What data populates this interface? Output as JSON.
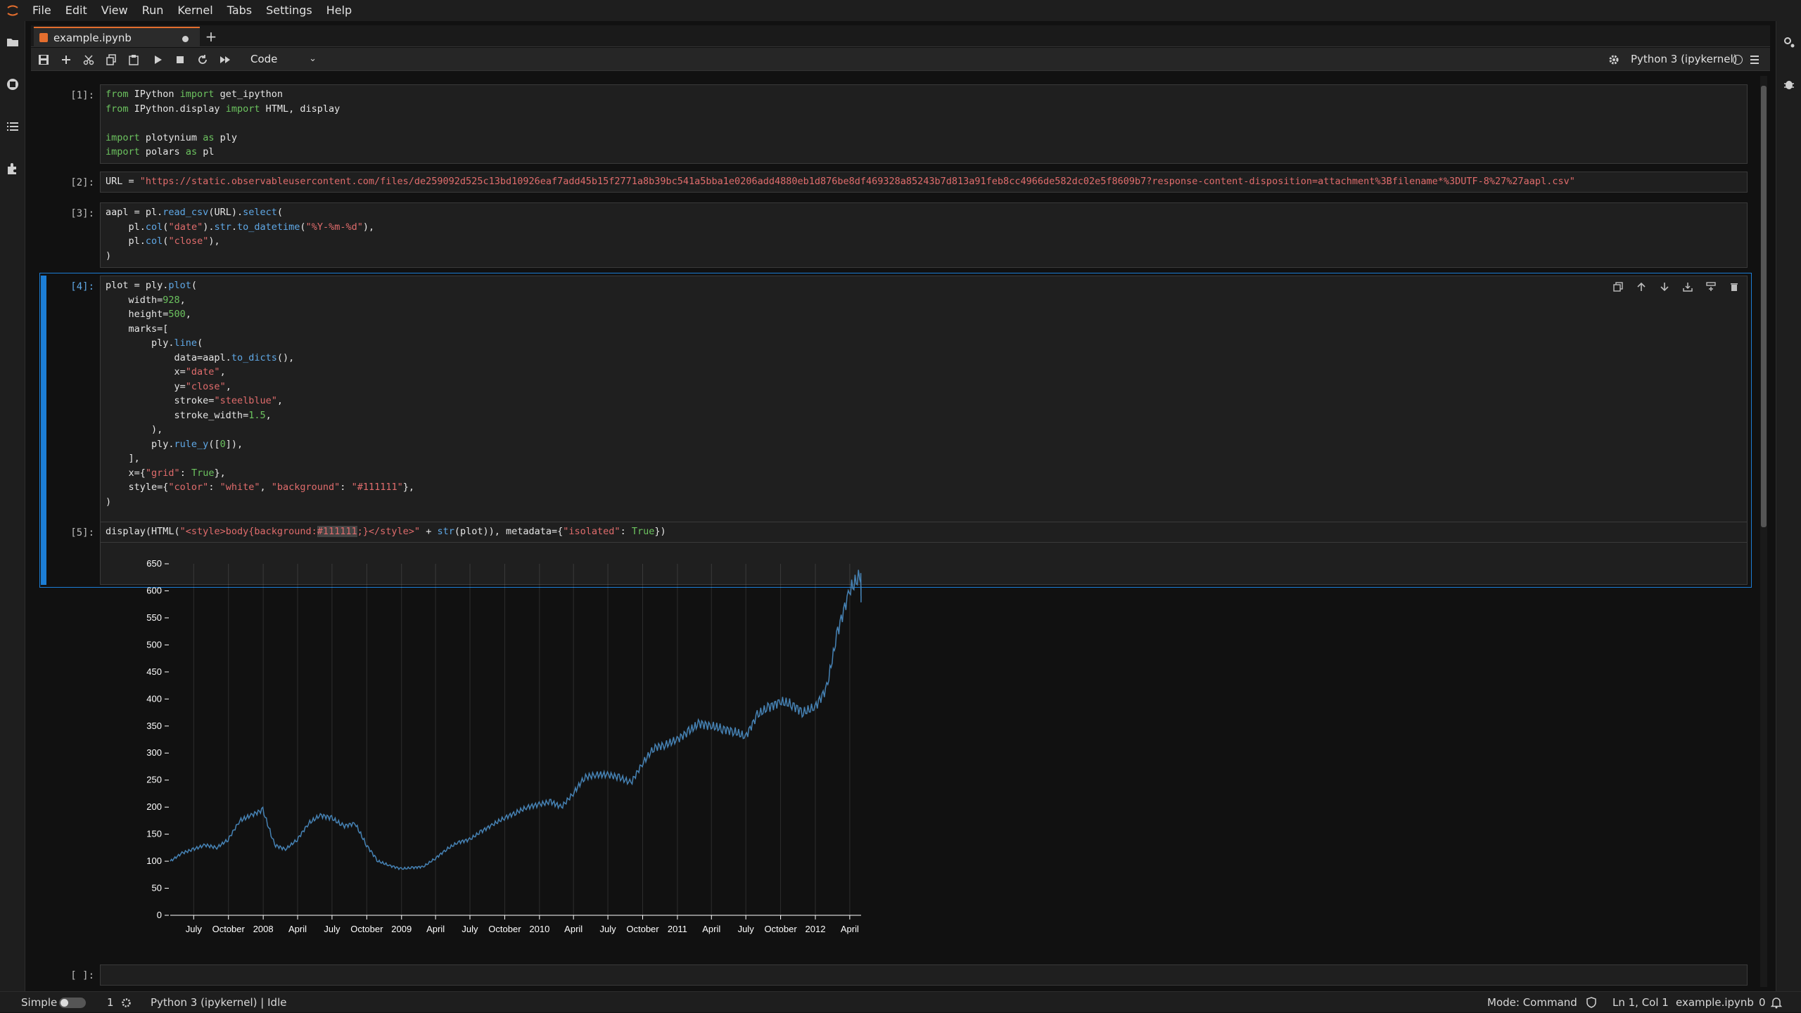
{
  "menu": [
    "File",
    "Edit",
    "View",
    "Run",
    "Kernel",
    "Tabs",
    "Settings",
    "Help"
  ],
  "tab": {
    "name": "example.ipynb",
    "add": "+"
  },
  "toolbar": {
    "cell_type": "Code",
    "kernel": "Python 3 (ipykernel)"
  },
  "cells": [
    {
      "prompt": "[1]:"
    },
    {
      "prompt": "[2]:"
    },
    {
      "prompt": "[3]:"
    },
    {
      "prompt": "[4]:"
    },
    {
      "prompt": "[5]:"
    },
    {
      "prompt": "[ ]:"
    }
  ],
  "status": {
    "mode_label": "Simple",
    "count": "1",
    "kernel_status": "Python 3 (ipykernel) | Idle",
    "mode": "Mode: Command",
    "position": "Ln 1, Col 1",
    "file": "example.ipynb",
    "notifications": "0"
  },
  "colors": {
    "accent": "#1c7ed6",
    "line": "#4682b4",
    "background": "#111111"
  },
  "chart_data": {
    "type": "line",
    "title": "",
    "xlabel": "",
    "ylabel": "",
    "y_ticks": [
      0,
      50,
      100,
      150,
      200,
      250,
      300,
      350,
      400,
      450,
      500,
      550,
      600,
      650
    ],
    "ylim": [
      0,
      650
    ],
    "x_tick_labels": [
      "July",
      "October",
      "2008",
      "April",
      "July",
      "October",
      "2009",
      "April",
      "July",
      "October",
      "2010",
      "April",
      "July",
      "October",
      "2011",
      "April",
      "July",
      "October",
      "2012",
      "April"
    ],
    "grid_x": true,
    "series": [
      {
        "x": [
          "2007-04-30",
          "2007-05-31",
          "2007-06-30",
          "2007-07-31",
          "2007-08-31",
          "2007-09-30",
          "2007-10-31",
          "2007-11-30",
          "2007-12-31",
          "2008-01-31",
          "2008-02-29",
          "2008-03-31",
          "2008-04-30",
          "2008-05-31",
          "2008-06-30",
          "2008-07-31",
          "2008-08-31",
          "2008-09-30",
          "2008-10-31",
          "2008-11-30",
          "2008-12-31",
          "2009-01-31",
          "2009-02-28",
          "2009-03-31",
          "2009-04-30",
          "2009-05-31",
          "2009-06-30",
          "2009-07-31",
          "2009-08-31",
          "2009-09-30",
          "2009-10-31",
          "2009-11-30",
          "2009-12-31",
          "2010-01-31",
          "2010-02-28",
          "2010-03-31",
          "2010-04-30",
          "2010-05-31",
          "2010-06-30",
          "2010-07-31",
          "2010-08-31",
          "2010-09-30",
          "2010-10-31",
          "2010-11-30",
          "2010-12-31",
          "2011-01-31",
          "2011-02-28",
          "2011-03-31",
          "2011-04-30",
          "2011-05-31",
          "2011-06-30",
          "2011-07-31",
          "2011-08-31",
          "2011-09-30",
          "2011-10-31",
          "2011-11-30",
          "2011-12-31",
          "2012-01-31",
          "2012-02-29",
          "2012-03-31",
          "2012-04-30",
          "2012-05-01"
        ],
        "y": [
          100,
          115,
          122,
          130,
          125,
          140,
          175,
          185,
          195,
          130,
          122,
          140,
          170,
          185,
          180,
          165,
          170,
          130,
          100,
          92,
          86,
          88,
          90,
          105,
          122,
          135,
          140,
          155,
          168,
          180,
          190,
          200,
          205,
          210,
          200,
          225,
          255,
          260,
          260,
          255,
          245,
          280,
          310,
          315,
          325,
          340,
          355,
          350,
          345,
          340,
          330,
          370,
          385,
          395,
          390,
          375,
          385,
          420,
          525,
          600,
          630,
          590
        ]
      }
    ]
  }
}
